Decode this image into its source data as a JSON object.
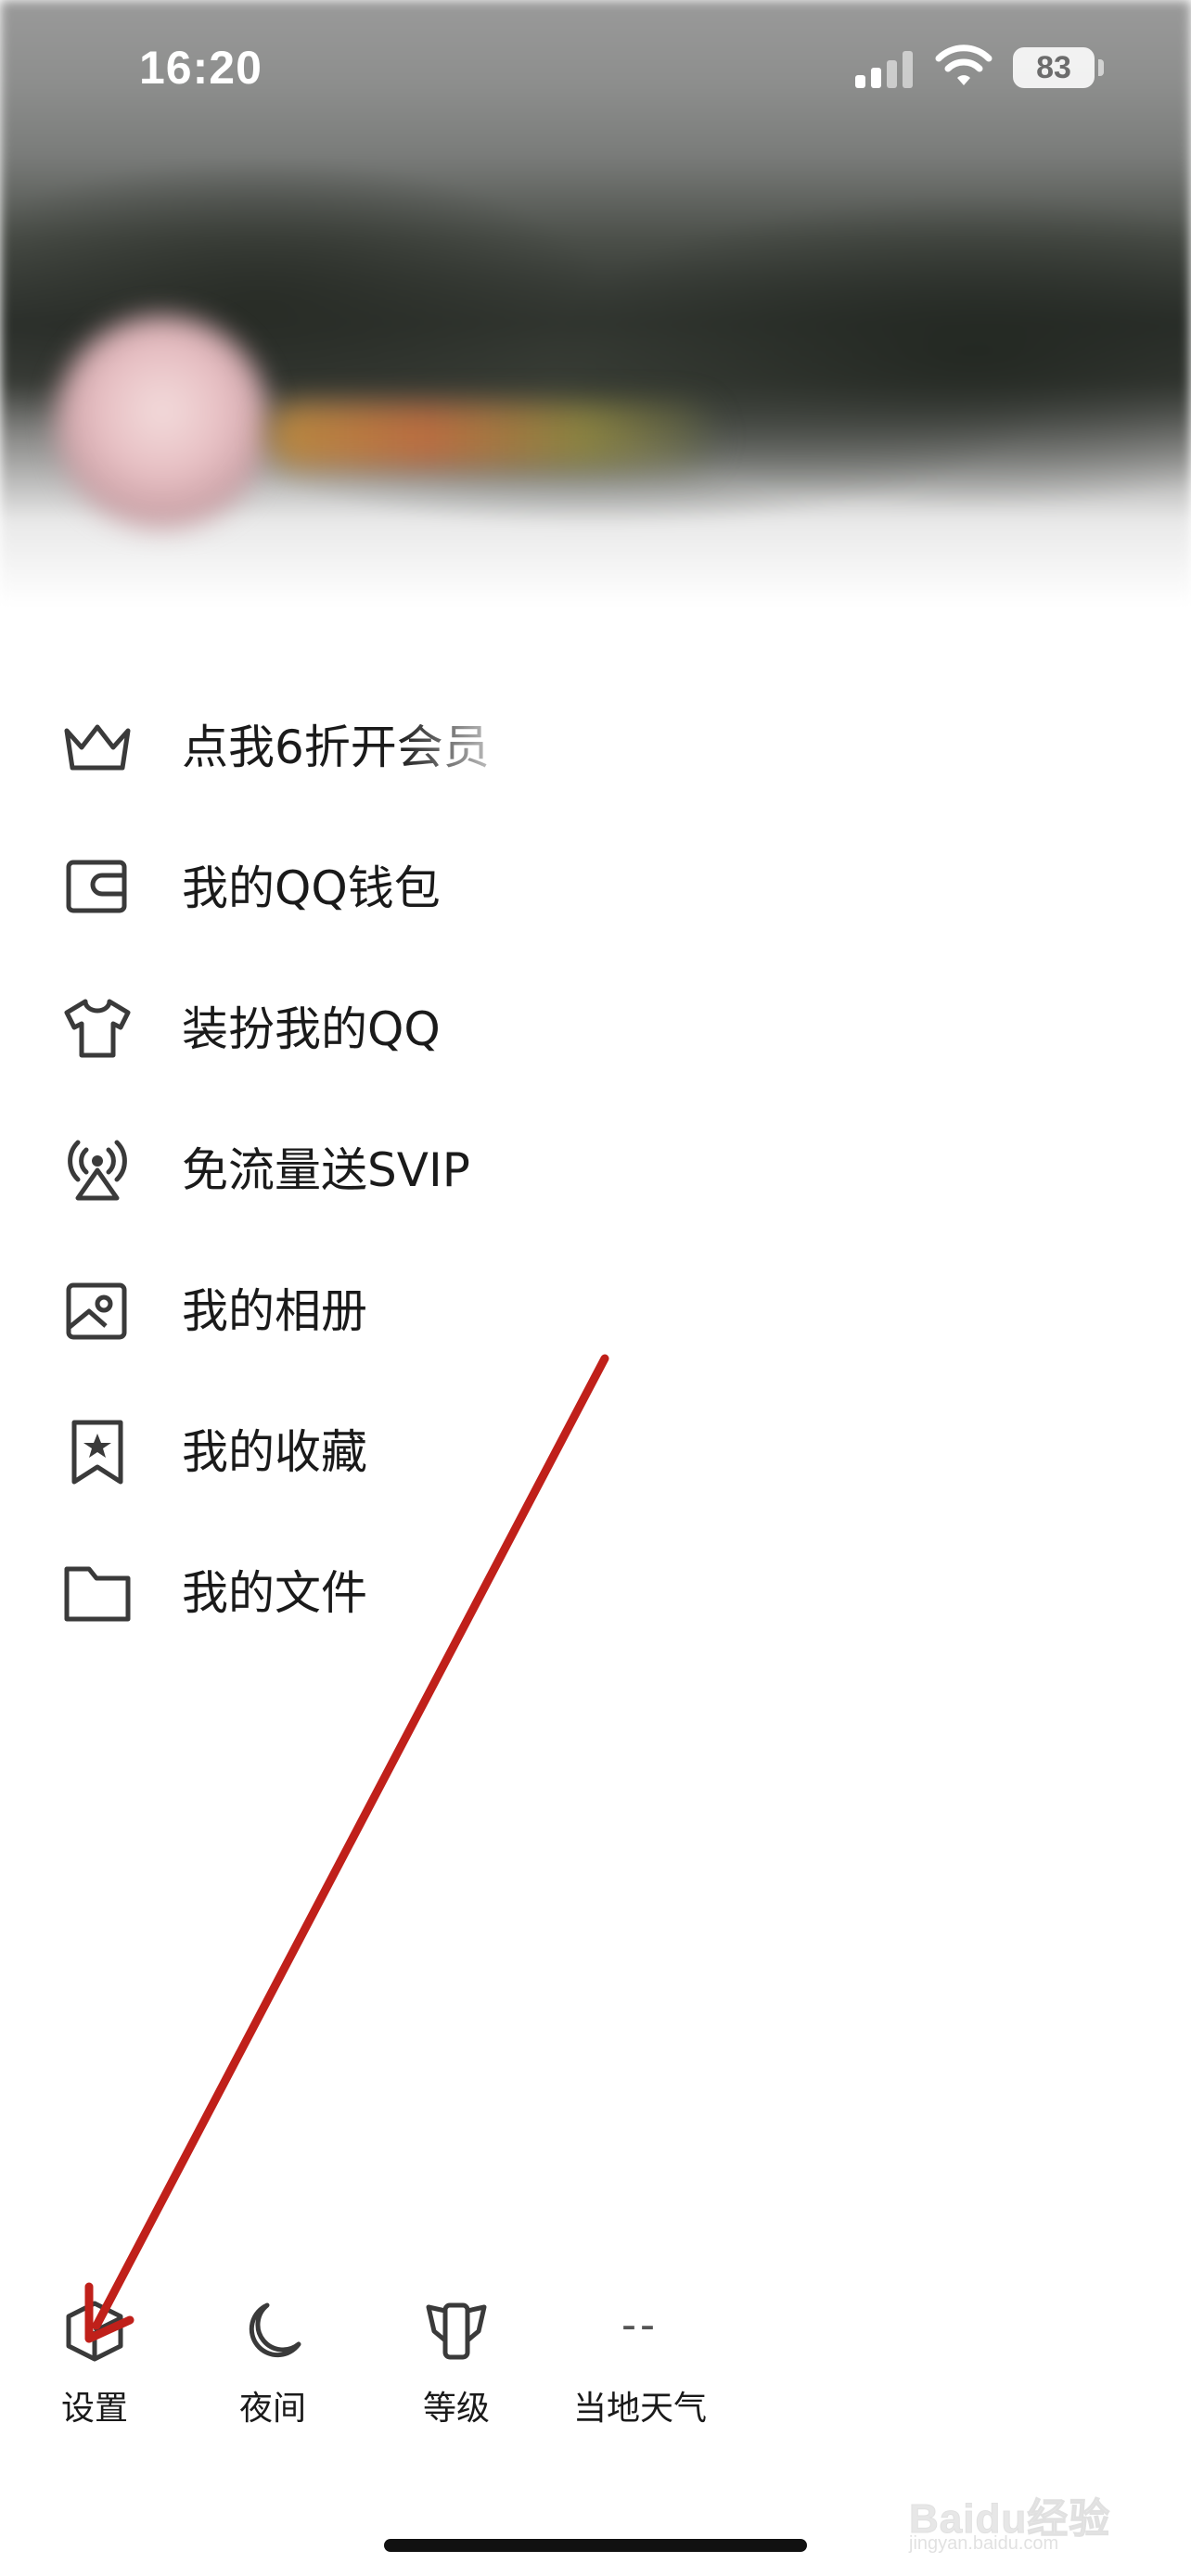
{
  "status_bar": {
    "time": "16:20",
    "battery": "83",
    "icons": [
      "cellular-signal-icon",
      "wifi-icon",
      "battery-icon"
    ]
  },
  "profile_header": {
    "avatar": "blurred-avatar",
    "name": "blurred-nickname"
  },
  "menu": {
    "items": [
      {
        "label": "点我6折开会员",
        "icon": "crown-icon"
      },
      {
        "label": "我的QQ钱包",
        "icon": "wallet-icon"
      },
      {
        "label": "装扮我的QQ",
        "icon": "tshirt-icon"
      },
      {
        "label": "免流量送SVIP",
        "icon": "broadcast-icon"
      },
      {
        "label": "我的相册",
        "icon": "photo-album-icon"
      },
      {
        "label": "我的收藏",
        "icon": "bookmark-star-icon"
      },
      {
        "label": "我的文件",
        "icon": "folder-icon"
      }
    ]
  },
  "bottom_bar": {
    "items": [
      {
        "label": "设置",
        "icon": "settings-hexagon-icon"
      },
      {
        "label": "夜间",
        "icon": "moon-icon"
      },
      {
        "label": "等级",
        "icon": "level-badge-icon"
      },
      {
        "label": "当地天气",
        "icon": "weather-placeholder",
        "value": "--"
      }
    ]
  },
  "annotation": {
    "type": "arrow",
    "color": "#c0201a"
  },
  "watermark": {
    "text": "Baidu经验",
    "sub": "jingyan.baidu.com"
  },
  "colors": {
    "text": "#1a1a1a",
    "icon": "#3a3a3a",
    "background": "#ffffff"
  }
}
